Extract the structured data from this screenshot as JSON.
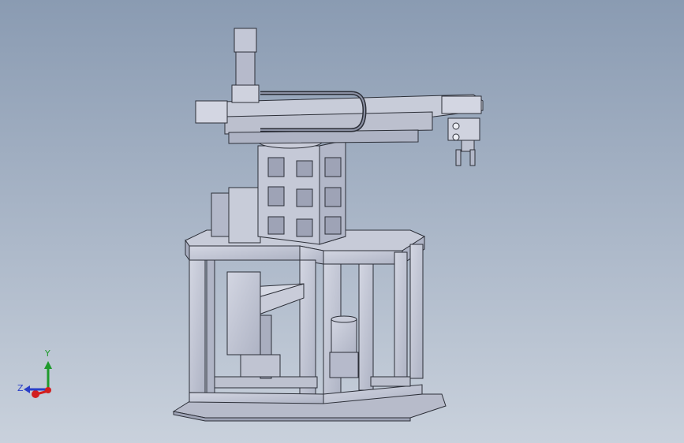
{
  "viewport": {
    "background_top": "#8a9bb2",
    "background_bottom": "#c9d1dc",
    "model_color": "#c3c7d6",
    "edge_color": "#2c2f38"
  },
  "triad": {
    "y_label": "Y",
    "z_label": "Z",
    "y_color": "#1f9a2c",
    "x_color": "#d21f1f",
    "z_color": "#2a3fc8"
  }
}
